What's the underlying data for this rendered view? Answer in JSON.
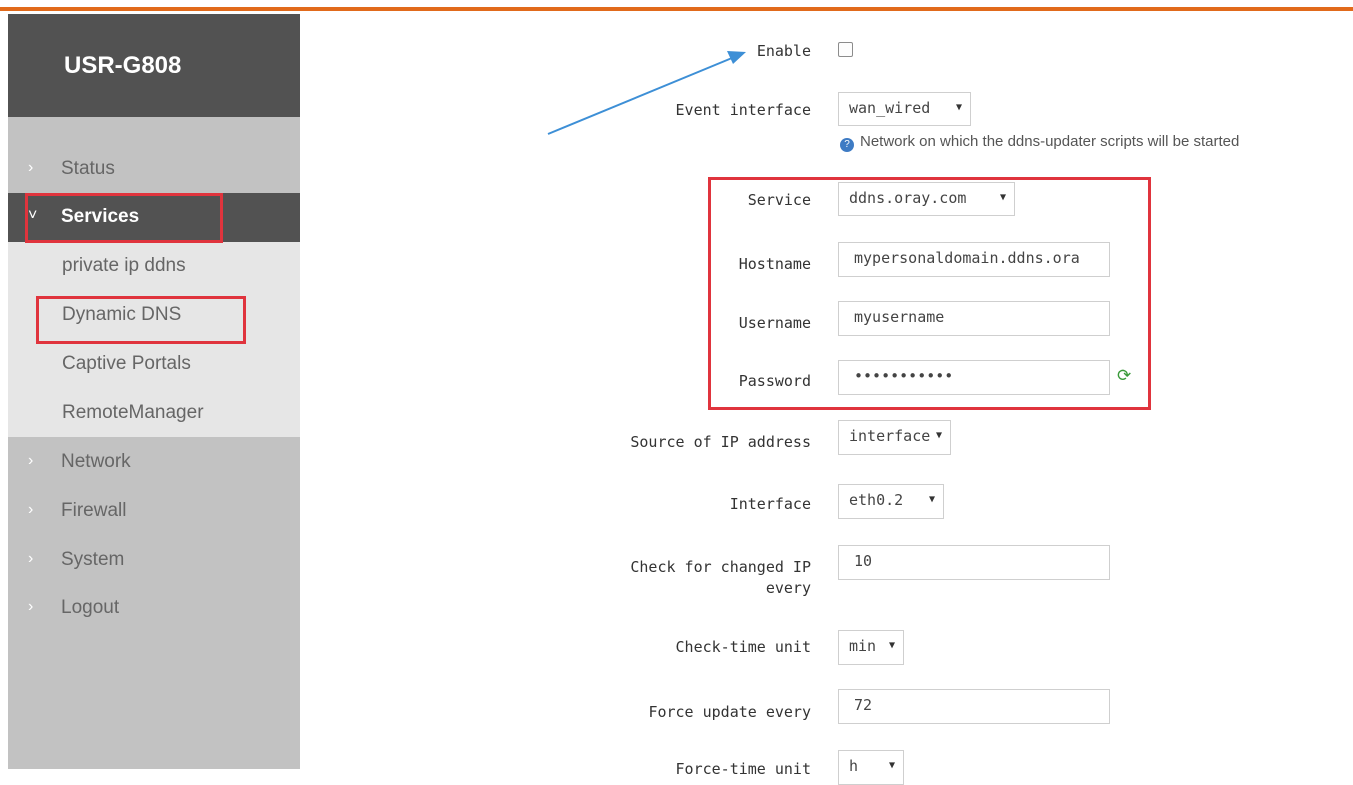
{
  "sidebar": {
    "brand": "USR-G808",
    "nav": {
      "status": "Status",
      "services": "Services",
      "network": "Network",
      "firewall": "Firewall",
      "system": "System",
      "logout": "Logout"
    },
    "services_submenu": {
      "private_ip_ddns": "private ip ddns",
      "dynamic_dns": "Dynamic DNS",
      "captive_portals": "Captive Portals",
      "remote_manager": "RemoteManager"
    }
  },
  "form": {
    "enable": {
      "label": "Enable",
      "checked": false
    },
    "event_interface": {
      "label": "Event interface",
      "value": "wan_wired",
      "hint": "Network on which the ddns-updater scripts will be started"
    },
    "service": {
      "label": "Service",
      "value": "ddns.oray.com"
    },
    "hostname": {
      "label": "Hostname",
      "value": "mypersonaldomain.ddns.ora"
    },
    "username": {
      "label": "Username",
      "value": "myusername"
    },
    "password": {
      "label": "Password",
      "value": "•••••••••••"
    },
    "source_ip": {
      "label": "Source of IP address",
      "value": "interface"
    },
    "interface": {
      "label": "Interface",
      "value": "eth0.2"
    },
    "check_interval": {
      "label_line1": "Check for changed IP",
      "label_line2": "every",
      "value": "10"
    },
    "check_time_unit": {
      "label": "Check-time unit",
      "value": "min"
    },
    "force_update": {
      "label": "Force update every",
      "value": "72"
    },
    "force_time_unit": {
      "label": "Force-time unit",
      "value": "h"
    }
  },
  "icons": {
    "chevron_right": "›",
    "chevron_down": "˅",
    "dropdown_arrow": "▼",
    "hint": "?",
    "reveal": "⟳"
  },
  "colors": {
    "accent": "#e16a1b",
    "sidebar_dark": "#525252",
    "sidebar_bg": "#c2c2c2",
    "submenu_bg": "#e6e6e6",
    "annotation_red": "#e0343d",
    "annotation_arrow": "#3d8fd6"
  }
}
